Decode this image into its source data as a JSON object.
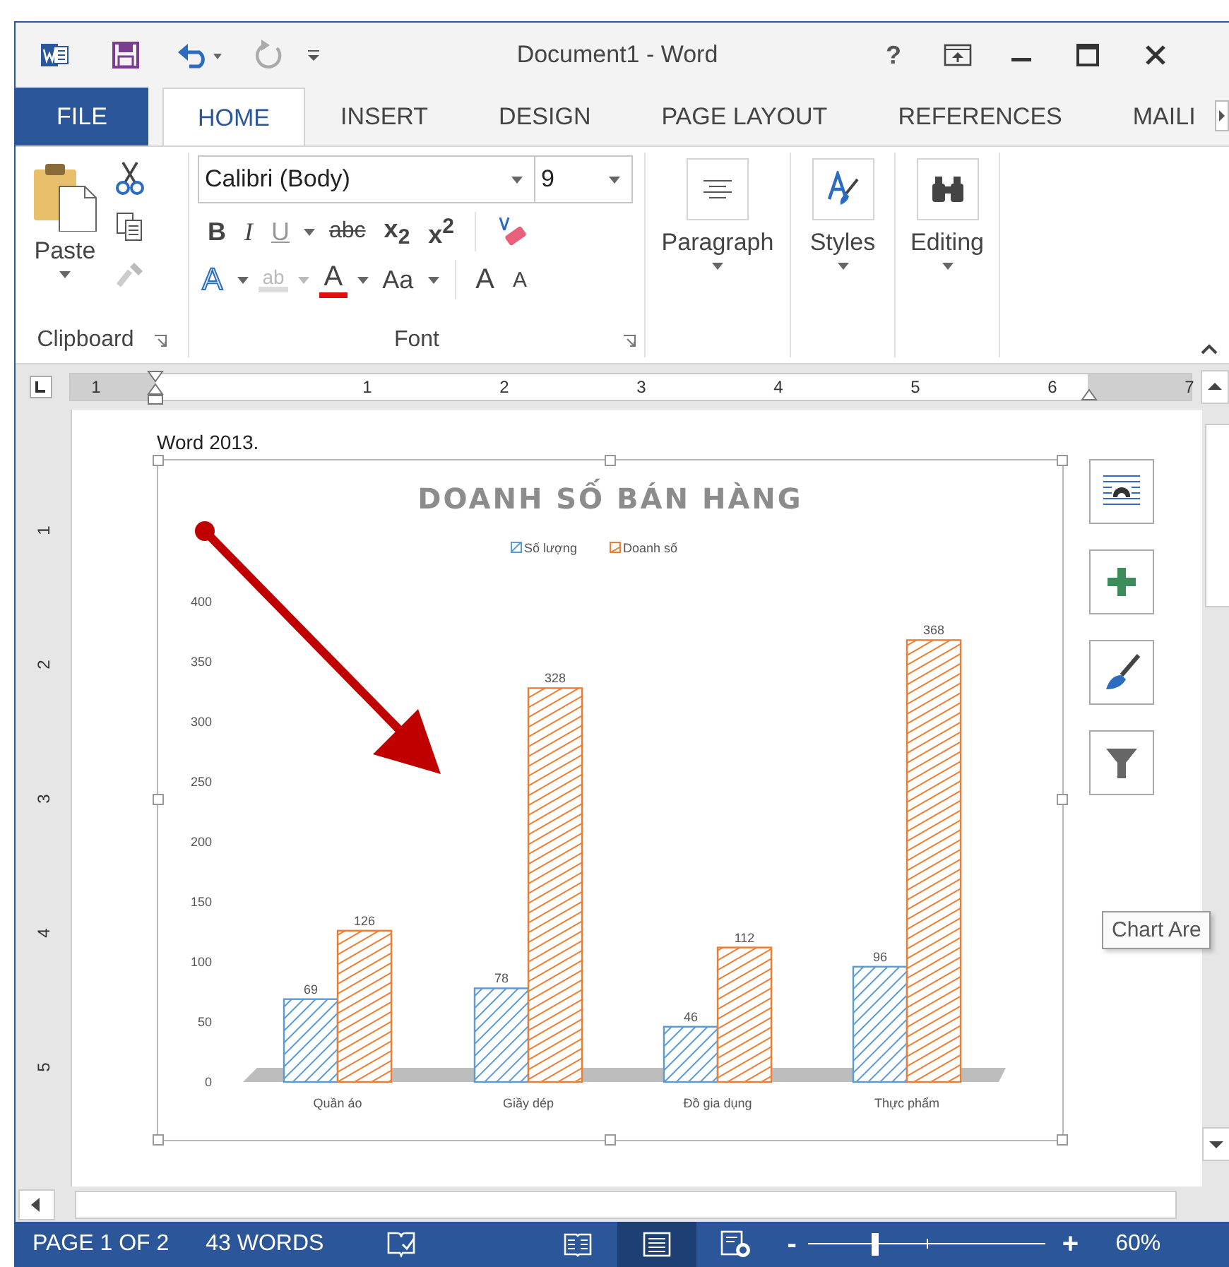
{
  "window": {
    "title": "Document1 - Word",
    "help": "?"
  },
  "tabs": [
    {
      "label": "FILE",
      "kind": "file",
      "selected": false
    },
    {
      "label": "HOME",
      "kind": "tab",
      "selected": true
    },
    {
      "label": "INSERT",
      "kind": "tab",
      "selected": false
    },
    {
      "label": "DESIGN",
      "kind": "tab",
      "selected": false
    },
    {
      "label": "PAGE LAYOUT",
      "kind": "tab",
      "selected": false
    },
    {
      "label": "REFERENCES",
      "kind": "tab",
      "selected": false
    },
    {
      "label": "MAILI",
      "kind": "tab",
      "selected": false
    }
  ],
  "ribbon": {
    "clipboard": {
      "paste": "Paste",
      "label": "Clipboard"
    },
    "font": {
      "name": "Calibri (Body)",
      "size": "9",
      "label": "Font",
      "format_buttons": [
        "B",
        "I",
        "U",
        "abc",
        "x$_{2}$",
        "x$^{2}$"
      ],
      "effects": "A",
      "highlight": "ab",
      "font_color": "A",
      "case": "Aa",
      "grow": "A",
      "shrink": "A"
    },
    "groups": [
      {
        "label": "Paragraph",
        "kind": "paragraph"
      },
      {
        "label": "Styles",
        "kind": "styles"
      },
      {
        "label": "Editing",
        "kind": "editing"
      }
    ]
  },
  "ruler": [
    "1",
    "1",
    "2",
    "3",
    "4",
    "5",
    "6",
    "7"
  ],
  "vertical_ruler": [
    "1",
    "2",
    "3",
    "4",
    "5"
  ],
  "document": {
    "text": "Word 2013.",
    "chart_data": {
      "type": "bar",
      "title": "DOANH SỐ BÁN HÀNG",
      "categories": [
        "Quần áo",
        "Giầy dép",
        "Đồ gia dụng",
        "Thực phẩm"
      ],
      "series": [
        {
          "name": "Số lượng",
          "color": "#5b9bd5",
          "values": [
            69,
            78,
            46,
            96
          ]
        },
        {
          "name": "Doanh số",
          "color": "#ed7d31",
          "values": [
            126,
            328,
            112,
            368
          ]
        }
      ],
      "yticks": [
        0,
        50,
        100,
        150,
        200,
        250,
        300,
        350,
        400
      ],
      "ylim": [
        0,
        400
      ],
      "data_labels": true,
      "legend": "top"
    },
    "tooltip": "Chart Are"
  },
  "status_bar": {
    "page": "PAGE 1 OF 2",
    "words": "43 WORDS",
    "views": [
      {
        "kind": "read",
        "selected": false
      },
      {
        "kind": "print",
        "selected": true
      },
      {
        "kind": "web",
        "selected": false
      }
    ],
    "zoom": {
      "minus": "-",
      "plus": "+",
      "level": 0.28,
      "reading": "60%"
    }
  }
}
